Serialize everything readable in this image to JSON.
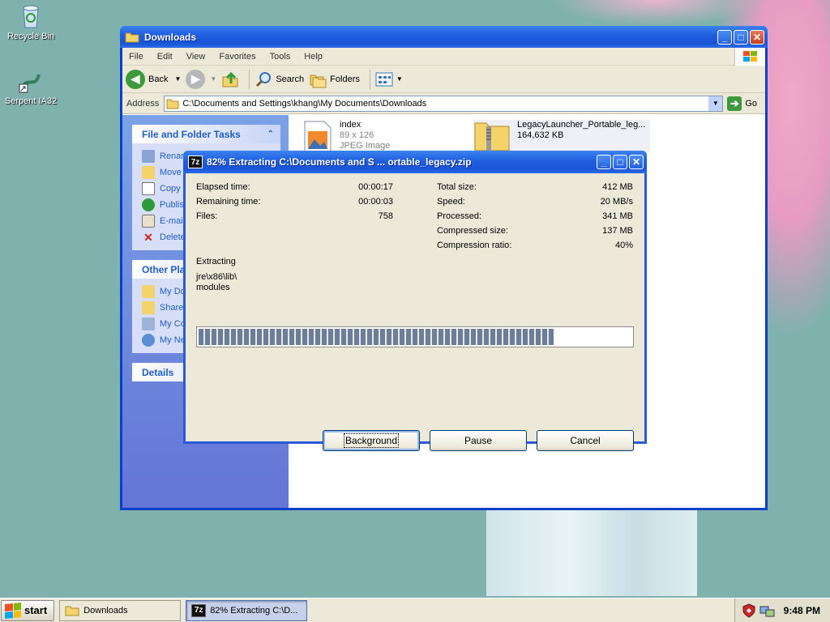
{
  "desktop": {
    "icons": [
      {
        "label": "Recycle Bin",
        "icon": "recycle-bin-icon"
      },
      {
        "label": "Serpent IA32",
        "icon": "serpent-shortcut-icon"
      }
    ]
  },
  "explorer": {
    "title": "Downloads",
    "menu": [
      "File",
      "Edit",
      "View",
      "Favorites",
      "Tools",
      "Help"
    ],
    "toolbar": {
      "back": "Back",
      "search": "Search",
      "folders": "Folders"
    },
    "address_label": "Address",
    "address_value": "C:\\Documents and Settings\\khang\\My Documents\\Downloads",
    "go_label": "Go",
    "taskpane": {
      "file_tasks_title": "File and Folder Tasks",
      "file_tasks": [
        "Renar",
        "Move",
        "Copy",
        "Publis",
        "E-mail",
        "Delete"
      ],
      "other_places_title": "Other Pla",
      "other_places": [
        "My Do",
        "Share",
        "My Co",
        "My Ne"
      ],
      "details_title": "Details"
    },
    "files": [
      {
        "name": "index",
        "line2": "89 x 126",
        "line3": "JPEG Image",
        "icon": "jpeg-image-icon"
      },
      {
        "name": "LegacyLauncher_Portable_leg...",
        "line2": "164,632 KB",
        "icon": "zip-folder-icon"
      }
    ]
  },
  "dialog": {
    "title": "82% Extracting C:\\Documents and S ... ortable_legacy.zip",
    "progress_percent": 82,
    "left_stats": [
      {
        "label": "Elapsed time:",
        "value": "00:00:17"
      },
      {
        "label": "Remaining time:",
        "value": "00:00:03"
      },
      {
        "label": "Files:",
        "value": "758"
      }
    ],
    "right_stats": [
      {
        "label": "Total size:",
        "value": "412 MB"
      },
      {
        "label": "Speed:",
        "value": "20 MB/s"
      },
      {
        "label": "Processed:",
        "value": "341 MB"
      },
      {
        "label": "Compressed size:",
        "value": "137 MB"
      },
      {
        "label": "Compression ratio:",
        "value": "40%"
      }
    ],
    "extracting_label": "Extracting",
    "current_path_1": "jre\\x86\\lib\\",
    "current_path_2": "modules",
    "buttons": {
      "background": "Background",
      "pause": "Pause",
      "cancel": "Cancel"
    }
  },
  "taskbar": {
    "start": "start",
    "tasks": [
      {
        "label": "Downloads",
        "icon": "folder-icon"
      },
      {
        "label": "82% Extracting C:\\D...",
        "icon": "7zip-icon"
      }
    ],
    "clock": "9:48 PM"
  },
  "colors": {
    "titlebar": "#1f5fe0",
    "taskpane": "#6c8fe0",
    "dialog_face": "#ece9d8"
  }
}
